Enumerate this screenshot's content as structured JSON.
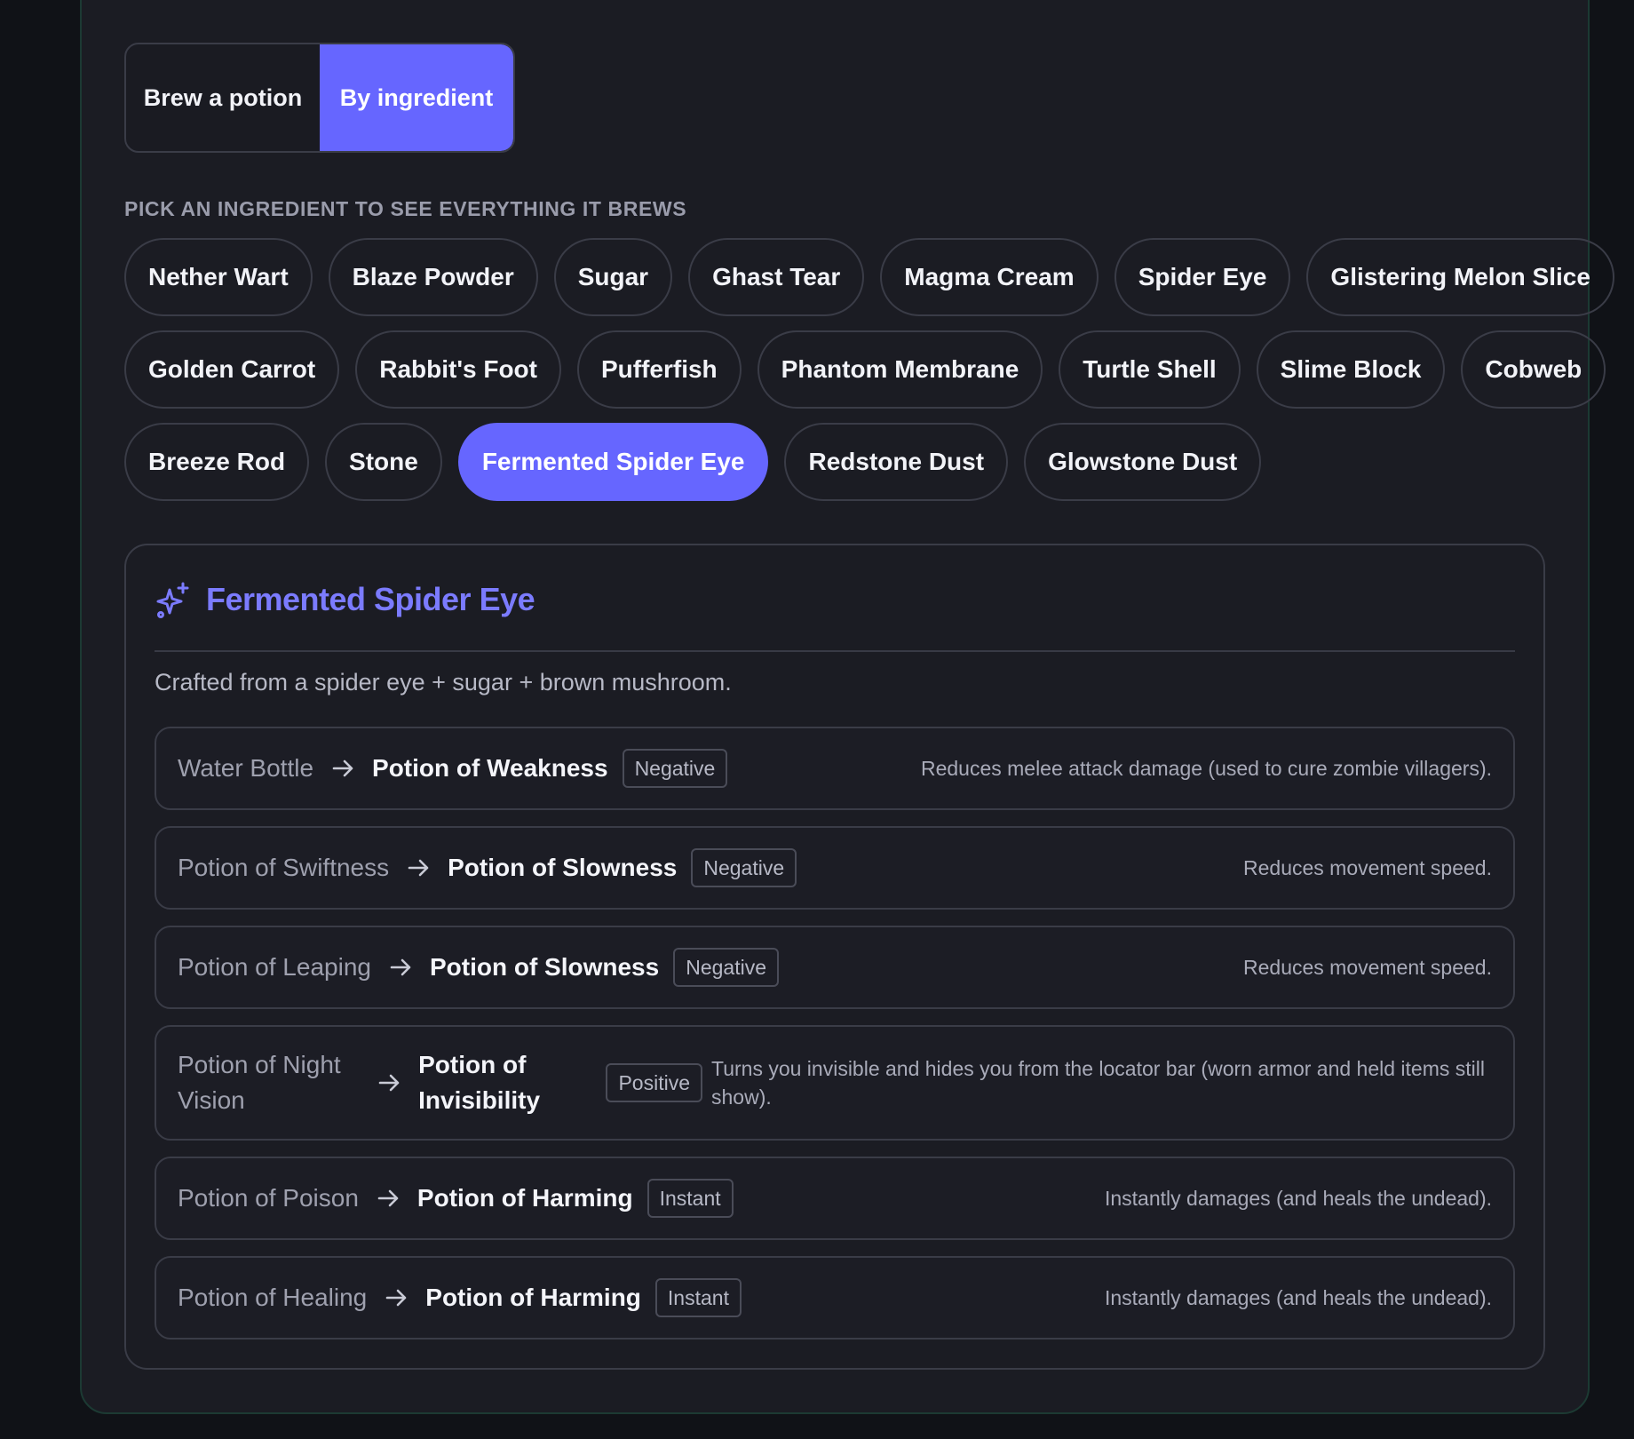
{
  "mode_toggle": {
    "options": [
      {
        "label": "Brew a potion",
        "active": false
      },
      {
        "label": "By ingredient",
        "active": true
      }
    ]
  },
  "section_label": "PICK AN INGREDIENT TO SEE EVERYTHING IT BREWS",
  "ingredients": {
    "rows": [
      [
        "Nether Wart",
        "Blaze Powder",
        "Sugar",
        "Ghast Tear",
        "Magma Cream",
        "Spider Eye",
        "Glistering Melon Slice"
      ],
      [
        "Golden Carrot",
        "Rabbit's Foot",
        "Pufferfish",
        "Phantom Membrane",
        "Turtle Shell",
        "Slime Block",
        "Cobweb"
      ],
      [
        "Breeze Rod",
        "Stone",
        "Fermented Spider Eye",
        "Redstone Dust",
        "Glowstone Dust"
      ]
    ],
    "selected": "Fermented Spider Eye"
  },
  "detail": {
    "icon": "sparkle-icon",
    "title": "Fermented Spider Eye",
    "description": "Crafted from a spider eye + sugar + brown mushroom.",
    "recipes": [
      {
        "from": "Water Bottle",
        "to": "Potion of Weakness",
        "badge": "Negative",
        "effect": "Reduces melee attack damage (used to cure zombie villagers)."
      },
      {
        "from": "Potion of Swiftness",
        "to": "Potion of Slowness",
        "badge": "Negative",
        "effect": "Reduces movement speed."
      },
      {
        "from": "Potion of Leaping",
        "to": "Potion of Slowness",
        "badge": "Negative",
        "effect": "Reduces movement speed."
      },
      {
        "from": "Potion of Night Vision",
        "to": "Potion of Invisibility",
        "badge": "Positive",
        "effect": "Turns you invisible and hides you from the locator bar (worn armor and held items still show)."
      },
      {
        "from": "Potion of Poison",
        "to": "Potion of Harming",
        "badge": "Instant",
        "effect": "Instantly damages (and heals the undead)."
      },
      {
        "from": "Potion of Healing",
        "to": "Potion of Harming",
        "badge": "Instant",
        "effect": "Instantly damages (and heals the undead)."
      }
    ]
  },
  "colors": {
    "accent": "#6666FF",
    "title_accent": "#7B7BFF",
    "background": "#101217",
    "panel": "#1B1C23",
    "border": "#3A3C47"
  }
}
